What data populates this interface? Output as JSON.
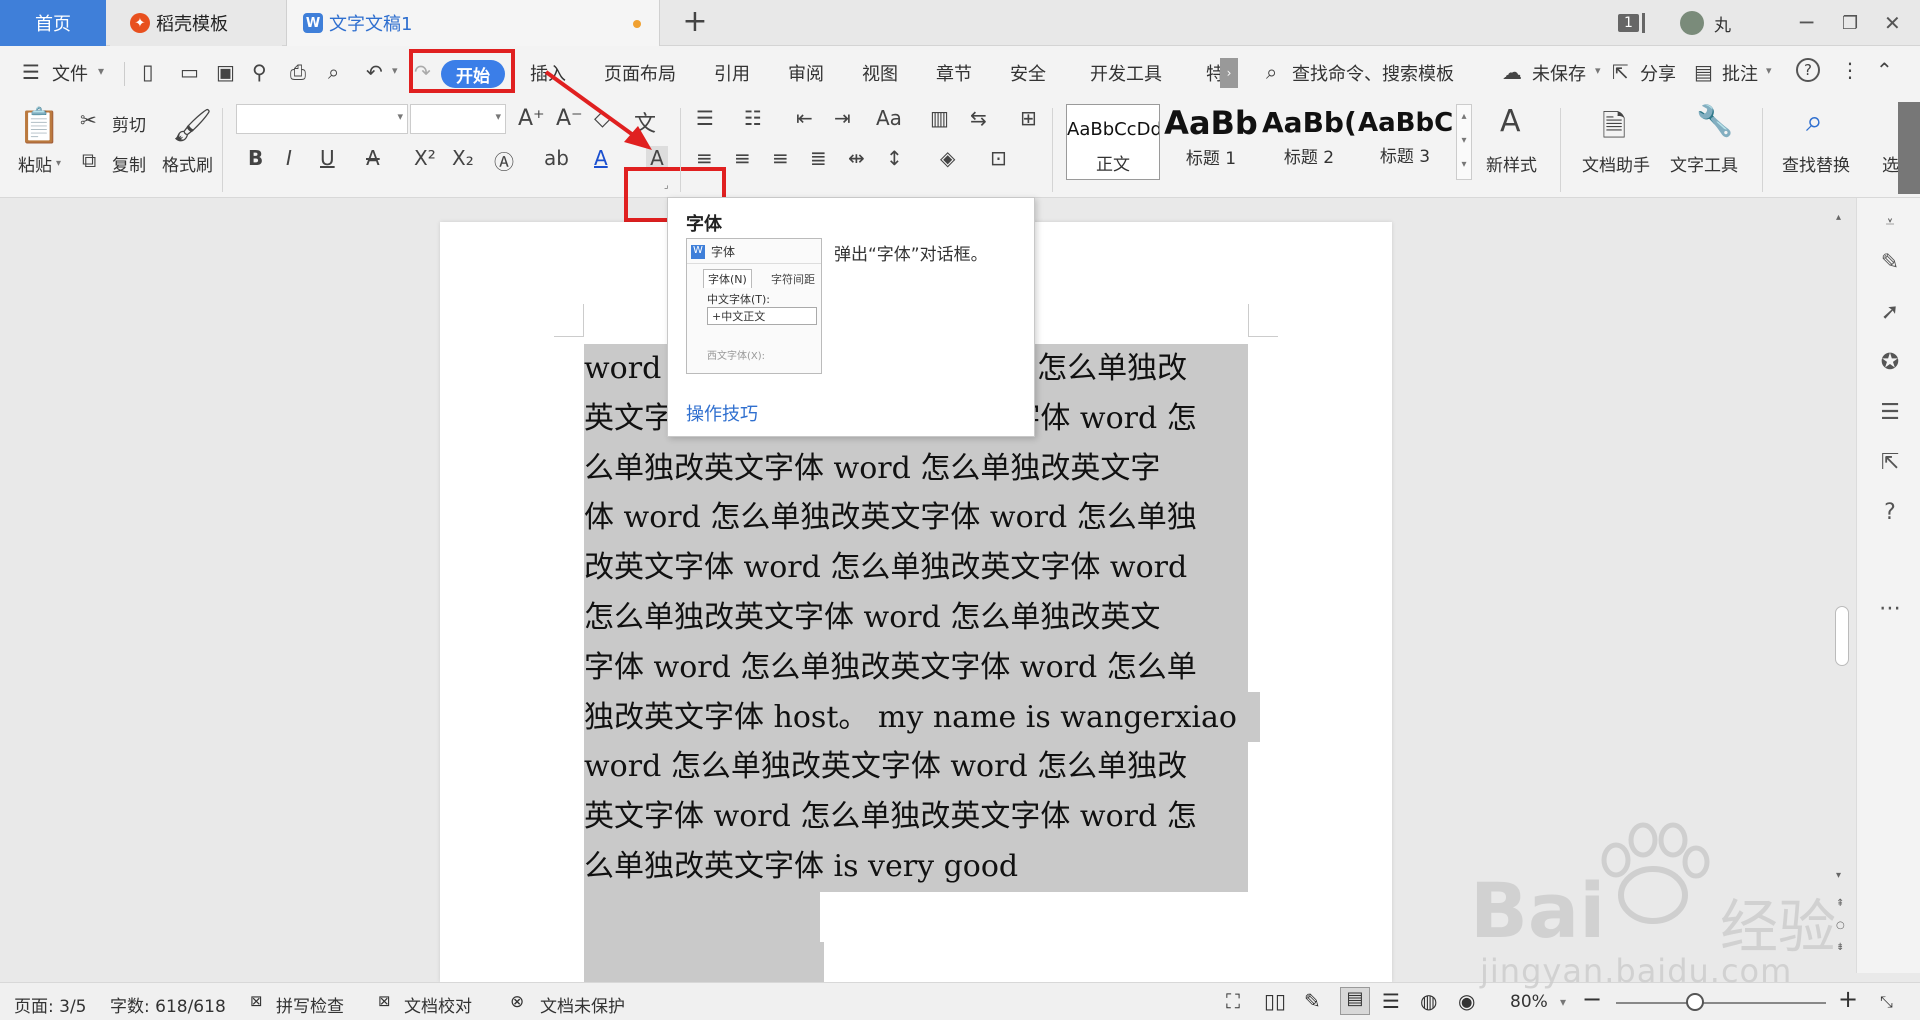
{
  "tabs": {
    "home": "首页",
    "daoke": "稻壳模板",
    "doc": "文字文稿1",
    "add": "+"
  },
  "window": {
    "page_badge": "1",
    "user": "丸"
  },
  "menu": {
    "file": "文件",
    "start": "开始",
    "insert": "插入",
    "layout": "页面布局",
    "reference": "引用",
    "review": "审阅",
    "view": "视图",
    "chapter": "章节",
    "security": "安全",
    "devtools": "开发工具",
    "special": "特",
    "search_placeholder": "查找命令、搜索模板",
    "unsaved": "未保存",
    "share": "分享",
    "comment": "批注"
  },
  "ribbon": {
    "paste": "粘贴",
    "cut": "剪切",
    "copy": "复制",
    "format_painter": "格式刷",
    "styles": [
      {
        "preview": "AaBbCcDd",
        "label": "正文"
      },
      {
        "preview": "AaBb",
        "label": "标题 1"
      },
      {
        "preview": "AaBb(",
        "label": "标题 2"
      },
      {
        "preview": "AaBbC",
        "label": "标题 3"
      }
    ],
    "new_style": "新样式",
    "doc_assistant": "文档助手",
    "text_tools": "文字工具",
    "find_replace": "查找替换",
    "select": "选"
  },
  "tooltip": {
    "title": "字体",
    "description": "弹出“字体”对话框。",
    "thumb_title": "字体",
    "thumb_tab1": "字体(N)",
    "thumb_tab2": "字符间距",
    "thumb_label1": "中文字体(T):",
    "thumb_value1": "+中文正文",
    "thumb_label2": "西文字体(X):",
    "link": "操作技巧"
  },
  "document": {
    "lines": [
      "word 怎么单独改英文字体 word 怎么单独改",
      "英文字体 word 怎么单独改英文字体 word 怎",
      "么单独改英文字体 word 怎么单独改英文字",
      "体 word 怎么单独改英文字体 word 怎么单独",
      "改英文字体 word 怎么单独改英文字体 word",
      "怎么单独改英文字体 word 怎么单独改英文",
      "字体 word 怎么单独改英文字体 word 怎么单",
      "独改英文字体 host。 my name is wangerxiao",
      "word 怎么单独改英文字体 word 怎么单独改",
      "英文字体 word 怎么单独改英文字体 word 怎",
      "么单独改英文字体 is very good"
    ]
  },
  "status": {
    "page": "页面: 3/5",
    "words": "字数: 618/618",
    "spell": "拼写检查",
    "proof": "文档校对",
    "protect": "文档未保护",
    "zoom": "80%"
  },
  "watermark": {
    "brand": "Bai",
    "cn": "经验",
    "url": "jingyan.baidu.com"
  },
  "colors": {
    "accent": "#3b7ee8",
    "home_tab": "#3f7fd9",
    "highlight_box": "#e02020",
    "selection": "#c9c9c9"
  }
}
